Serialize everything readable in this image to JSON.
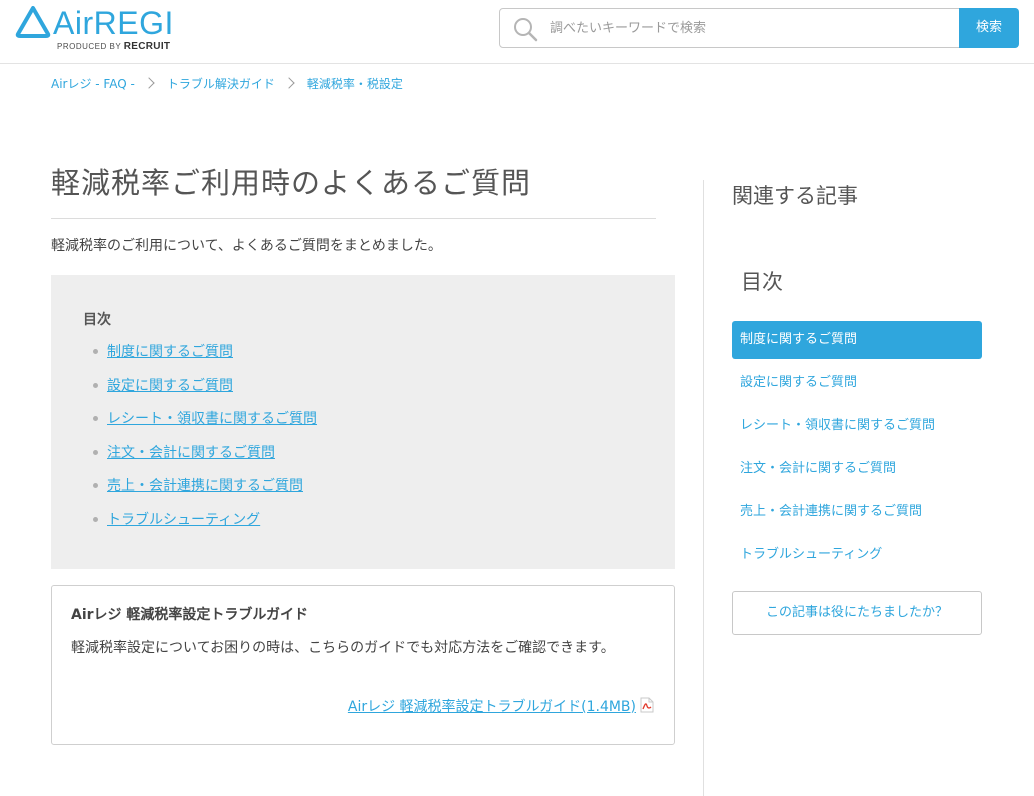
{
  "header": {
    "logo_name": "AirREGI",
    "logo_produced_by": "PRODUCED BY",
    "logo_company": "RECRUIT",
    "search_placeholder": "調べたいキーワードで検索",
    "search_button": "検索"
  },
  "breadcrumb": [
    {
      "label": "Airレジ - FAQ -"
    },
    {
      "label": "トラブル解決ガイド"
    },
    {
      "label": "軽減税率・税設定"
    }
  ],
  "main": {
    "title": "軽減税率ご利用時のよくあるご質問",
    "lead": "軽減税率のご利用について、よくあるご質問をまとめました。",
    "toc": {
      "heading": "目次",
      "items": [
        {
          "label": "制度に関するご質問"
        },
        {
          "label": "設定に関するご質問"
        },
        {
          "label": "レシート・領収書に関するご質問"
        },
        {
          "label": "注文・会計に関するご質問"
        },
        {
          "label": "売上・会計連携に関するご質問"
        },
        {
          "label": "トラブルシューティング"
        }
      ]
    },
    "guide": {
      "title": "Airレジ 軽減税率設定トラブルガイド",
      "text": "軽減税率設定についてお困りの時は、こちらのガイドでも対応方法をご確認できます。",
      "link": "Airレジ 軽減税率設定トラブルガイド(1.4MB)",
      "icon": "pdf-icon"
    }
  },
  "sidebar": {
    "related_heading": "関連する記事",
    "toc_heading": "目次",
    "items": [
      {
        "label": "制度に関するご質問",
        "active": true
      },
      {
        "label": "設定に関するご質問"
      },
      {
        "label": "レシート・領収書に関するご質問"
      },
      {
        "label": "注文・会計に関するご質問"
      },
      {
        "label": "売上・会計連携に関するご質問"
      },
      {
        "label": "トラブルシューティング"
      }
    ],
    "feedback_button": "この記事は役にたちましたか？"
  },
  "colors": {
    "accent": "#2fa6dd",
    "toc_background": "#eeeeee"
  }
}
